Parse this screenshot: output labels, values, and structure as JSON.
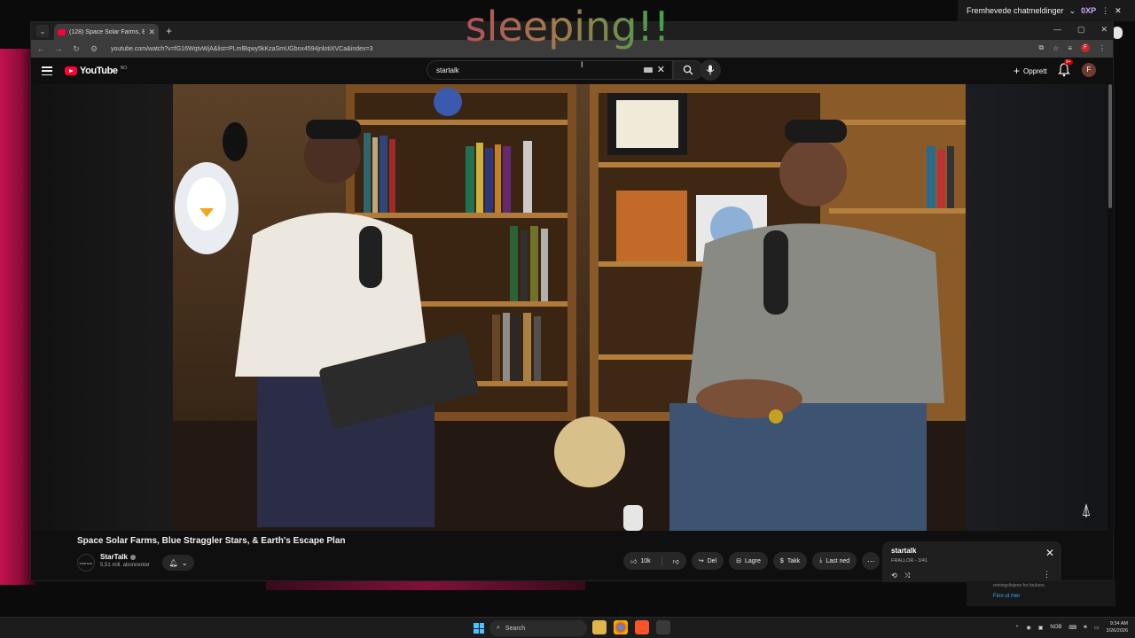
{
  "overlay": {
    "text": "sleeping!!"
  },
  "chat_bar": {
    "label": "Fremhevede chatmeldinger",
    "badge": "0XP"
  },
  "browser": {
    "tab_title": "(128) Space Solar Farms, Bl...",
    "url": "youtube.com/watch?v=fG16WqtvWjA&list=PLmlBqwy5kKzaSmUGbnx4594jnlotiXVCa&index=3"
  },
  "youtube": {
    "logo_text": "YouTube",
    "logo_region": "NO",
    "search_value": "startalk",
    "create_label": "Opprett",
    "notifications_badge": "9+",
    "user_initial": "F"
  },
  "video": {
    "title": "Space Solar Farms, Blue Straggler Stars, & Earth's Escape Plan",
    "channel_name": "StarTalk",
    "channel_avatar_text": "STARTALK",
    "subscribers": "5,51 mill. abonnenter",
    "like_count": "10k",
    "share_label": "Del",
    "save_label": "Lagre",
    "thanks_label": "Takk",
    "download_label": "Last ned"
  },
  "playlist": {
    "title": "startalk",
    "subtitle": "FRALLOR - 3/41"
  },
  "sidebar_hint": {
    "text": "retningslinjene for brukere.",
    "link": "Finn ut mer"
  },
  "taskbar": {
    "search_label": "Search",
    "lang": "NOB",
    "time": "9:34 AM",
    "date": "3/26/2026"
  },
  "colors": {
    "youtube_red": "#ff0033",
    "accent_blue": "#3ea6ff",
    "windows_blue": "#4cc2ff"
  }
}
